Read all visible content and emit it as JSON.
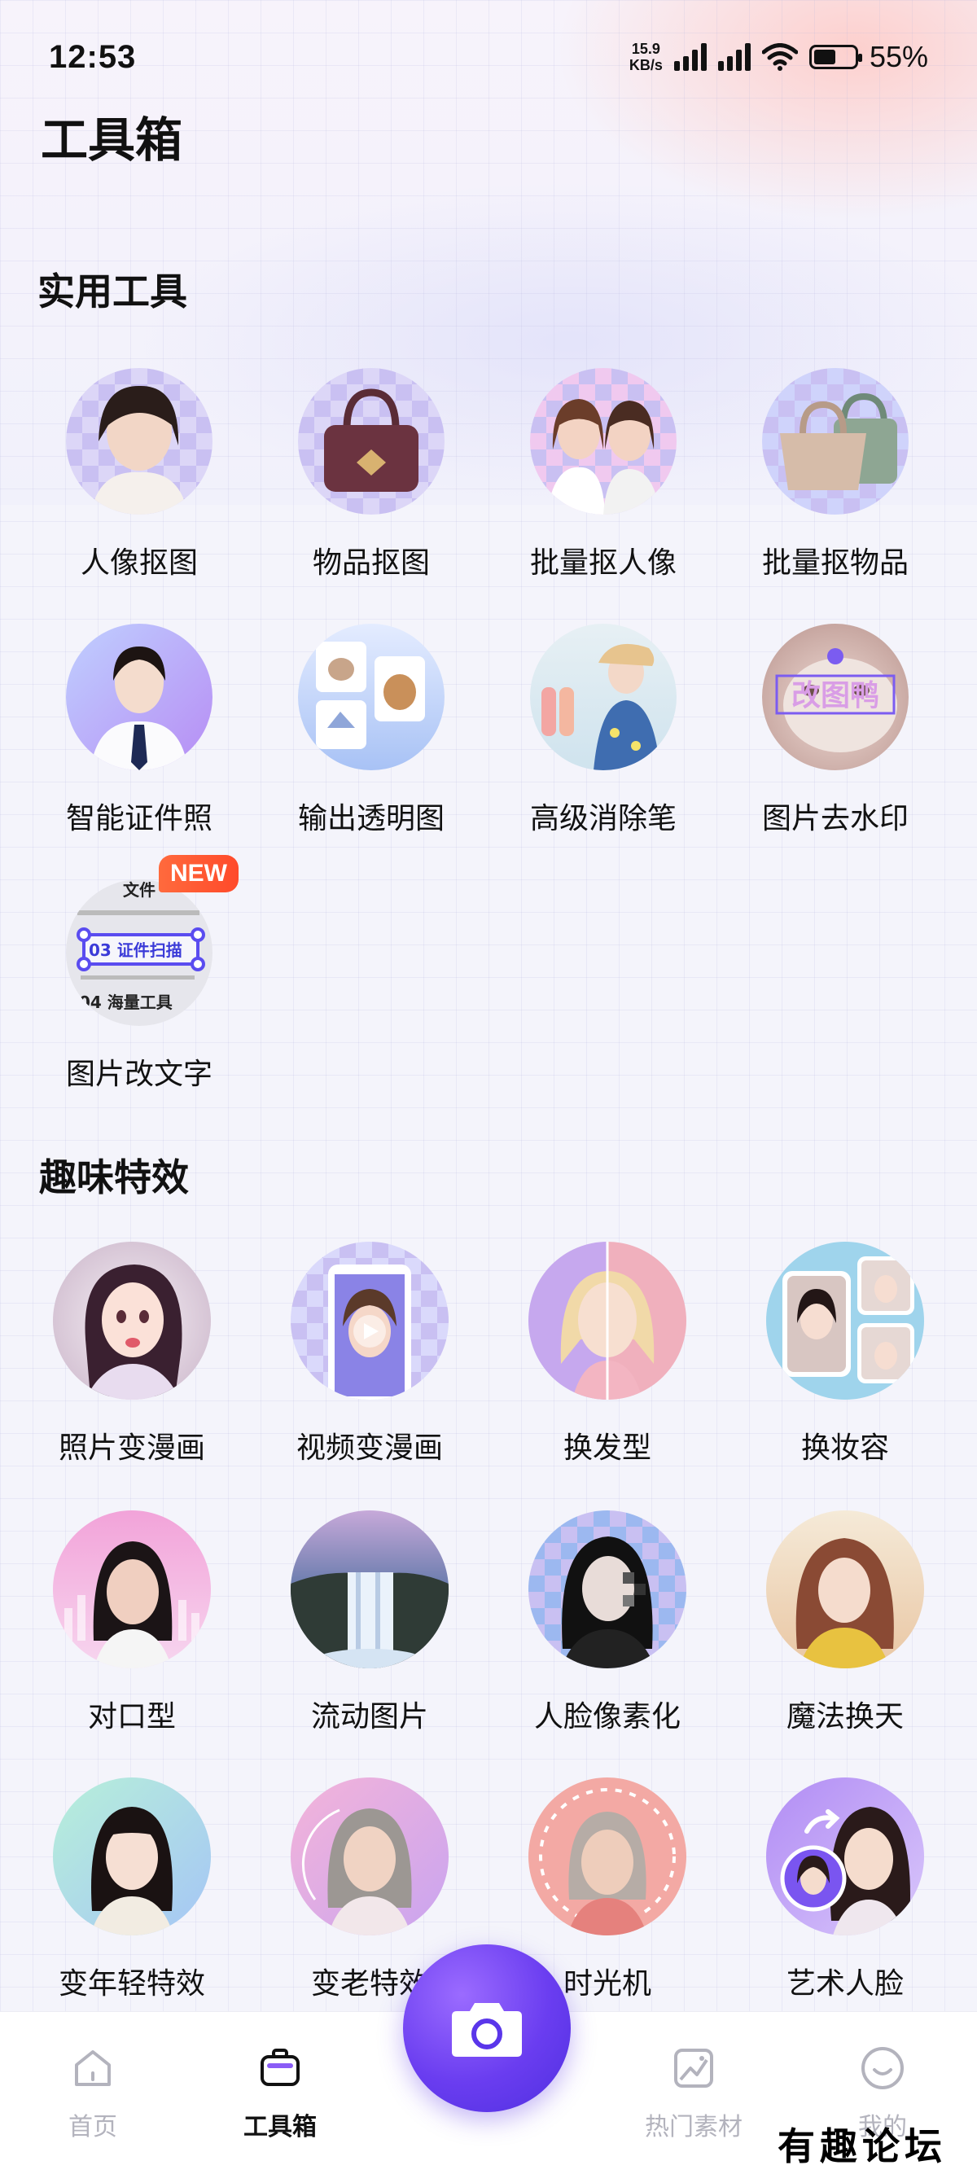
{
  "status_bar": {
    "time": "12:53",
    "net_speed_value": "15.9",
    "net_speed_unit": "KB/s",
    "battery": "55%",
    "battery_level": 0.55
  },
  "page_title": "工具箱",
  "sections": {
    "practical": {
      "title": "实用工具",
      "items": [
        {
          "label": "人像抠图",
          "icon": "portrait-cutout-icon"
        },
        {
          "label": "物品抠图",
          "icon": "object-cutout-icon"
        },
        {
          "label": "批量抠人像",
          "icon": "batch-portrait-icon"
        },
        {
          "label": "批量抠物品",
          "icon": "batch-object-icon"
        },
        {
          "label": "智能证件照",
          "icon": "id-photo-icon"
        },
        {
          "label": "输出透明图",
          "icon": "transparent-output-icon"
        },
        {
          "label": "高级消除笔",
          "icon": "eraser-pen-icon"
        },
        {
          "label": "图片去水印",
          "icon": "remove-watermark-icon"
        },
        {
          "label": "图片改文字",
          "icon": "edit-text-icon"
        }
      ],
      "badge": "NEW",
      "thumb_texts": {
        "watermark_sample": "改图鸭",
        "scan_line_1": "文件",
        "scan_line_2": "03 证件扫描",
        "scan_line_3": "04 海量工具"
      }
    },
    "fun": {
      "title": "趣味特效",
      "items": [
        {
          "label": "照片变漫画",
          "icon": "photo-to-comic-icon"
        },
        {
          "label": "视频变漫画",
          "icon": "video-to-comic-icon"
        },
        {
          "label": "换发型",
          "icon": "hairstyle-icon"
        },
        {
          "label": "换妆容",
          "icon": "makeup-icon"
        },
        {
          "label": "对口型",
          "icon": "lip-sync-icon"
        },
        {
          "label": "流动图片",
          "icon": "flowing-image-icon"
        },
        {
          "label": "人脸像素化",
          "icon": "face-pixelate-icon"
        },
        {
          "label": "魔法换天",
          "icon": "sky-replace-icon"
        },
        {
          "label": "变年轻特效",
          "icon": "younger-icon"
        },
        {
          "label": "变老特效",
          "icon": "older-icon"
        },
        {
          "label": "时光机",
          "icon": "time-machine-icon"
        },
        {
          "label": "艺术人脸",
          "icon": "art-face-icon"
        }
      ]
    }
  },
  "tabbar": {
    "items": [
      {
        "label": "首页",
        "icon": "home-icon"
      },
      {
        "label": "工具箱",
        "icon": "toolbox-icon"
      },
      {
        "label": "热门素材",
        "icon": "hot-material-icon"
      },
      {
        "label": "我的",
        "icon": "profile-icon"
      }
    ],
    "fab_icon": "camera-icon"
  },
  "watermark": "有趣论坛",
  "colors": {
    "accent": "#6a3df0",
    "badge": "#ff5a30"
  }
}
